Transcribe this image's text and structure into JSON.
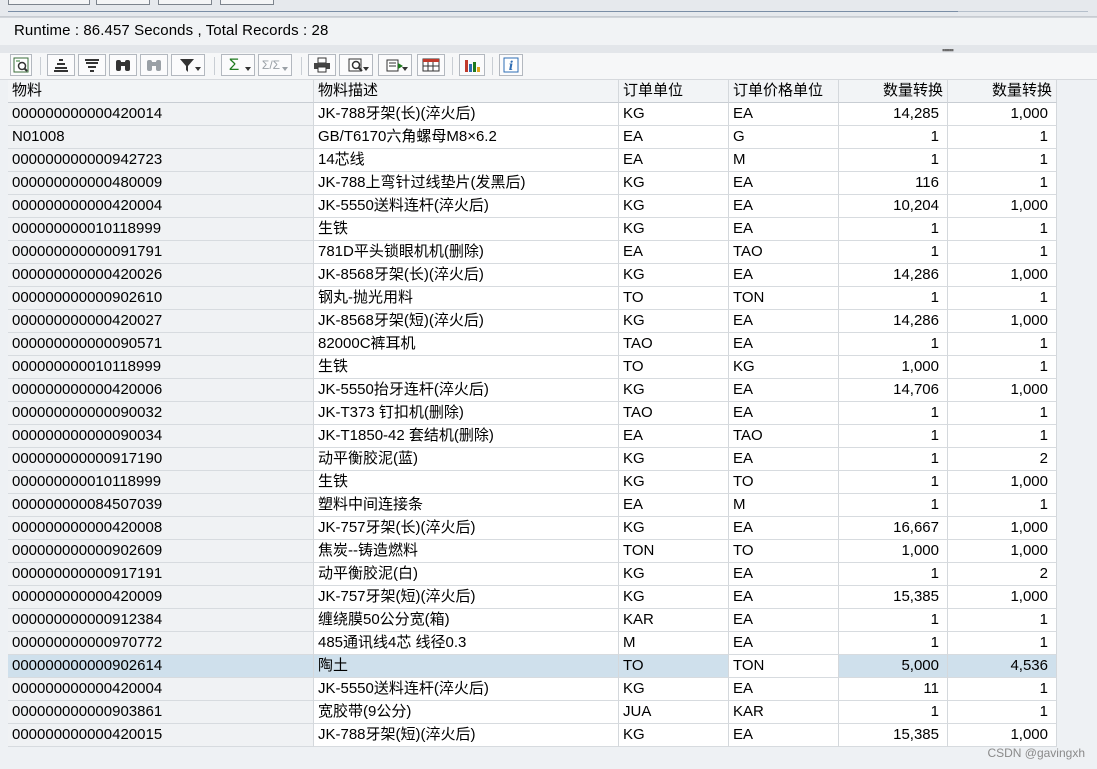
{
  "runtime_text": "Runtime : 86.457  Seconds , Total Records : 28",
  "toolbar": {
    "icons": [
      "details-icon",
      "sort-ascending-icon",
      "sort-descending-icon",
      "find-icon",
      "find-next-icon",
      "filter-icon",
      "sum-icon",
      "subtotal-icon",
      "print-icon",
      "print-preview-icon",
      "export-icon",
      "layout-icon",
      "chart-icon",
      "info-icon"
    ]
  },
  "columns": [
    "物料",
    "物料描述",
    "订单单位",
    "订单价格单位",
    "数量转换",
    "数量转换"
  ],
  "rows": [
    [
      "000000000000420014",
      "JK-788牙架(长)(淬火后)",
      "KG",
      "EA",
      "14,285",
      "1,000"
    ],
    [
      "N01008",
      "GB/T6170六角螺母M8×6.2",
      "EA",
      "G",
      "1",
      "1"
    ],
    [
      "000000000000942723",
      "14芯线",
      "EA",
      "M",
      "1",
      "1"
    ],
    [
      "000000000000480009",
      "JK-788上弯针过线垫片(发黑后)",
      "KG",
      "EA",
      "116",
      "1"
    ],
    [
      "000000000000420004",
      "JK-5550送料连杆(淬火后)",
      "KG",
      "EA",
      "10,204",
      "1,000"
    ],
    [
      "000000000010118999",
      "生铁",
      "KG",
      "EA",
      "1",
      "1"
    ],
    [
      "000000000000091791",
      "781D平头锁眼机机(删除)",
      "EA",
      "TAO",
      "1",
      "1"
    ],
    [
      "000000000000420026",
      "JK-8568牙架(长)(淬火后)",
      "KG",
      "EA",
      "14,286",
      "1,000"
    ],
    [
      "000000000000902610",
      "钢丸-抛光用料",
      "TO",
      "TON",
      "1",
      "1"
    ],
    [
      "000000000000420027",
      "JK-8568牙架(短)(淬火后)",
      "KG",
      "EA",
      "14,286",
      "1,000"
    ],
    [
      "000000000000090571",
      "82000C裤耳机",
      "TAO",
      "EA",
      "1",
      "1"
    ],
    [
      "000000000010118999",
      "生铁",
      "TO",
      "KG",
      "1,000",
      "1"
    ],
    [
      "000000000000420006",
      "JK-5550抬牙连杆(淬火后)",
      "KG",
      "EA",
      "14,706",
      "1,000"
    ],
    [
      "000000000000090032",
      "JK-T373  钉扣机(删除)",
      "TAO",
      "EA",
      "1",
      "1"
    ],
    [
      "000000000000090034",
      "JK-T1850-42  套结机(删除)",
      "EA",
      "TAO",
      "1",
      "1"
    ],
    [
      "000000000000917190",
      "动平衡胶泥(蓝)",
      "KG",
      "EA",
      "1",
      "2"
    ],
    [
      "000000000010118999",
      "生铁",
      "KG",
      "TO",
      "1",
      "1,000"
    ],
    [
      "000000000084507039",
      "塑料中间连接条",
      "EA",
      "M",
      "1",
      "1"
    ],
    [
      "000000000000420008",
      "JK-757牙架(长)(淬火后)",
      "KG",
      "EA",
      "16,667",
      "1,000"
    ],
    [
      "000000000000902609",
      "焦炭--铸造燃料",
      "TON",
      "TO",
      "1,000",
      "1,000"
    ],
    [
      "000000000000917191",
      "动平衡胶泥(白)",
      "KG",
      "EA",
      "1",
      "2"
    ],
    [
      "000000000000420009",
      "JK-757牙架(短)(淬火后)",
      "KG",
      "EA",
      "15,385",
      "1,000"
    ],
    [
      "000000000000912384",
      "缠绕膜50公分宽(箱)",
      "KAR",
      "EA",
      "1",
      "1"
    ],
    [
      "000000000000970772",
      "485通讯线4芯 线径0.3",
      "M",
      "EA",
      "1",
      "1"
    ],
    [
      "000000000000902614",
      "陶土",
      "TO",
      "TON",
      "5,000",
      "4,536"
    ],
    [
      "000000000000420004",
      "JK-5550送料连杆(淬火后)",
      "KG",
      "EA",
      "11",
      "1"
    ],
    [
      "000000000000903861",
      "宽胶带(9公分)",
      "JUA",
      "KAR",
      "1",
      "1"
    ],
    [
      "000000000000420015",
      "JK-788牙架(短)(淬火后)",
      "KG",
      "EA",
      "15,385",
      "1,000"
    ]
  ],
  "selected_row_index": 24,
  "watermark": "CSDN @gavingxh"
}
